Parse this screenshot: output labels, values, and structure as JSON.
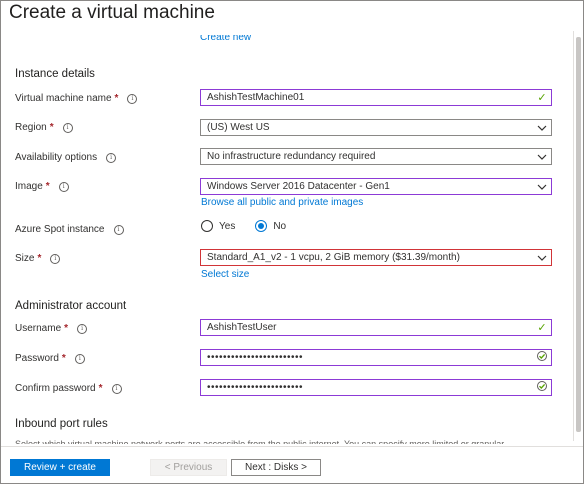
{
  "page": {
    "title": "Create a virtual machine"
  },
  "top_link": "Create new",
  "instance_details": {
    "heading": "Instance details",
    "vm_name": {
      "label": "Virtual machine name",
      "value": "AshishTestMachine01"
    },
    "region": {
      "label": "Region",
      "value": "(US) West US"
    },
    "availability": {
      "label": "Availability options",
      "value": "No infrastructure redundancy required"
    },
    "image": {
      "label": "Image",
      "value": "Windows Server 2016 Datacenter - Gen1",
      "link": "Browse all public and private images"
    },
    "spot": {
      "label": "Azure Spot instance",
      "options": [
        "Yes",
        "No"
      ],
      "selected": "No"
    },
    "size": {
      "label": "Size",
      "value": "Standard_A1_v2 - 1 vcpu, 2 GiB memory ($31.39/month)",
      "link": "Select size"
    }
  },
  "admin_account": {
    "heading": "Administrator account",
    "username": {
      "label": "Username",
      "value": "AshishTestUser"
    },
    "password": {
      "label": "Password",
      "value": "••••••••••••••••••••••••"
    },
    "confirm_password": {
      "label": "Confirm password",
      "value": "••••••••••••••••••••••••"
    }
  },
  "inbound": {
    "heading": "Inbound port rules",
    "truncated_text": "Select which virtual machine network ports are accessible from the public internet. You can specify more limited or granular"
  },
  "footer": {
    "review_label": "Review + create",
    "previous_label": "< Previous",
    "next_label": "Next : Disks >"
  },
  "colors": {
    "accent": "#0078d4",
    "required": "#a4262c",
    "valid": "#57a300",
    "error_border": "#d13438",
    "focus_border": "#8c3ad6"
  }
}
